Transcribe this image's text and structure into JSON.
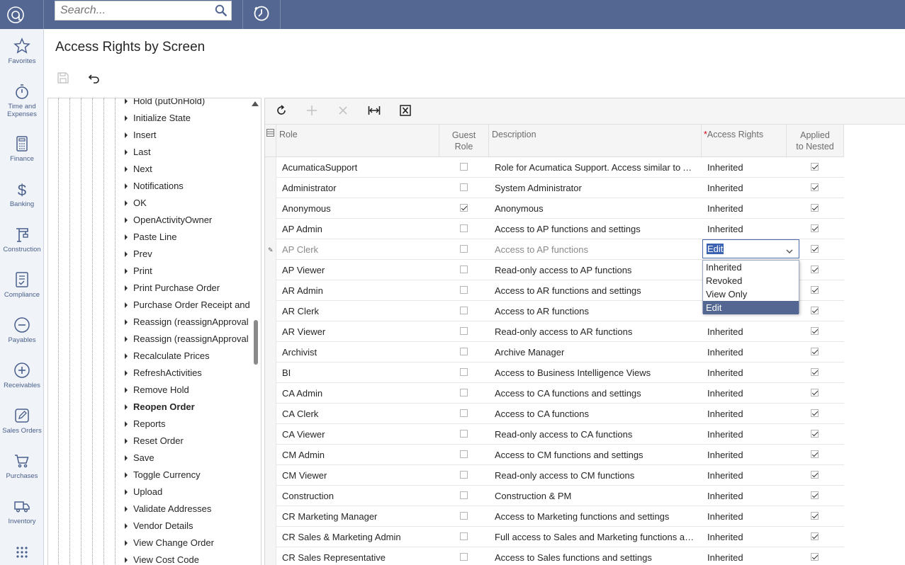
{
  "search": {
    "placeholder": "Search..."
  },
  "nav": [
    {
      "label": "Favorites",
      "icon": "star-icon"
    },
    {
      "label": "Time and Expenses",
      "icon": "stopwatch-icon"
    },
    {
      "label": "Finance",
      "icon": "calculator-icon"
    },
    {
      "label": "Banking",
      "icon": "dollar-icon"
    },
    {
      "label": "Construction",
      "icon": "crane-icon"
    },
    {
      "label": "Compliance",
      "icon": "checklist-icon"
    },
    {
      "label": "Payables",
      "icon": "minus-circle-icon"
    },
    {
      "label": "Receivables",
      "icon": "plus-circle-icon"
    },
    {
      "label": "Sales Orders",
      "icon": "pencil-icon"
    },
    {
      "label": "Purchases",
      "icon": "cart-icon"
    },
    {
      "label": "Inventory",
      "icon": "truck-icon"
    },
    {
      "label": "",
      "icon": "more-grid-icon"
    }
  ],
  "page": {
    "title": "Access Rights by Screen"
  },
  "tree": {
    "items": [
      {
        "label": "Hold (putOnHold)",
        "bold": false
      },
      {
        "label": "Initialize State",
        "bold": false
      },
      {
        "label": "Insert",
        "bold": false
      },
      {
        "label": "Last",
        "bold": false
      },
      {
        "label": "Next",
        "bold": false
      },
      {
        "label": "Notifications",
        "bold": false
      },
      {
        "label": "OK",
        "bold": false
      },
      {
        "label": "OpenActivityOwner",
        "bold": false
      },
      {
        "label": "Paste Line",
        "bold": false
      },
      {
        "label": "Prev",
        "bold": false
      },
      {
        "label": "Print",
        "bold": false
      },
      {
        "label": "Print Purchase Order",
        "bold": false
      },
      {
        "label": "Purchase Order Receipt and",
        "bold": false
      },
      {
        "label": "Reassign (reassignApproval",
        "bold": false
      },
      {
        "label": "Reassign (reassignApproval",
        "bold": false
      },
      {
        "label": "Recalculate Prices",
        "bold": false
      },
      {
        "label": "RefreshActivities",
        "bold": false
      },
      {
        "label": "Remove Hold",
        "bold": false
      },
      {
        "label": "Reopen Order",
        "bold": true
      },
      {
        "label": "Reports",
        "bold": false
      },
      {
        "label": "Reset Order",
        "bold": false
      },
      {
        "label": "Save",
        "bold": false
      },
      {
        "label": "Toggle Currency",
        "bold": false
      },
      {
        "label": "Upload",
        "bold": false
      },
      {
        "label": "Validate Addresses",
        "bold": false
      },
      {
        "label": "Vendor Details",
        "bold": false
      },
      {
        "label": "View Change Order",
        "bold": false
      },
      {
        "label": "View Cost Code",
        "bold": false
      }
    ]
  },
  "grid": {
    "columns": {
      "role": "Role",
      "guest_line1": "Guest",
      "guest_line2": "Role",
      "description": "Description",
      "required_mark": "*",
      "access": "Access Rights",
      "nested_line1": "Applied",
      "nested_line2": "to Nested"
    },
    "rows": [
      {
        "role": "AcumaticaSupport",
        "guest": false,
        "description": "Role for Acumatica Support. Access similar to Administrator",
        "access": "Inherited",
        "nested": true
      },
      {
        "role": "Administrator",
        "guest": false,
        "description": "System Administrator",
        "access": "Inherited",
        "nested": true
      },
      {
        "role": "Anonymous",
        "guest": true,
        "description": "Anonymous",
        "access": "Inherited",
        "nested": true
      },
      {
        "role": "AP Admin",
        "guest": false,
        "description": "Access to AP functions and settings",
        "access": "Inherited",
        "nested": true
      },
      {
        "role": "AP Clerk",
        "guest": false,
        "description": "Access to AP functions",
        "access": "",
        "nested": true
      },
      {
        "role": "AP Viewer",
        "guest": false,
        "description": "Read-only access to AP functions",
        "access": "",
        "nested": true
      },
      {
        "role": "AR Admin",
        "guest": false,
        "description": "Access to AR functions and settings",
        "access": "",
        "nested": true
      },
      {
        "role": "AR Clerk",
        "guest": false,
        "description": "Access to AR functions",
        "access": "",
        "nested": true
      },
      {
        "role": "AR Viewer",
        "guest": false,
        "description": "Read-only access to AR functions",
        "access": "Inherited",
        "nested": true
      },
      {
        "role": "Archivist",
        "guest": false,
        "description": "Archive Manager",
        "access": "Inherited",
        "nested": true
      },
      {
        "role": "BI",
        "guest": false,
        "description": "Access to Business Intelligence Views",
        "access": "Inherited",
        "nested": true
      },
      {
        "role": "CA Admin",
        "guest": false,
        "description": "Access to CA functions and settings",
        "access": "Inherited",
        "nested": true
      },
      {
        "role": "CA Clerk",
        "guest": false,
        "description": "Access to CA functions",
        "access": "Inherited",
        "nested": true
      },
      {
        "role": "CA Viewer",
        "guest": false,
        "description": "Read-only access to CA functions",
        "access": "Inherited",
        "nested": true
      },
      {
        "role": "CM Admin",
        "guest": false,
        "description": "Access to CM functions and settings",
        "access": "Inherited",
        "nested": true
      },
      {
        "role": "CM Viewer",
        "guest": false,
        "description": "Read-only access to CM functions",
        "access": "Inherited",
        "nested": true
      },
      {
        "role": "Construction",
        "guest": false,
        "description": "Construction & PM",
        "access": "Inherited",
        "nested": true
      },
      {
        "role": "CR Marketing Manager",
        "guest": false,
        "description": "Access to Marketing functions and settings",
        "access": "Inherited",
        "nested": true
      },
      {
        "role": "CR Sales & Marketing Admin",
        "guest": false,
        "description": "Full access to Sales and Marketing functions and settings",
        "access": "Inherited",
        "nested": true
      },
      {
        "role": "CR Sales Representative",
        "guest": false,
        "description": "Access to Sales functions and settings",
        "access": "Inherited",
        "nested": true
      }
    ],
    "editor": {
      "value": "Edit",
      "options": [
        "Inherited",
        "Revoked",
        "View Only",
        "Edit"
      ],
      "selected_index": 3
    }
  },
  "colors": {
    "topbar": "#536792",
    "accent": "#3b62b3",
    "nav_text": "#4a5f8c"
  }
}
